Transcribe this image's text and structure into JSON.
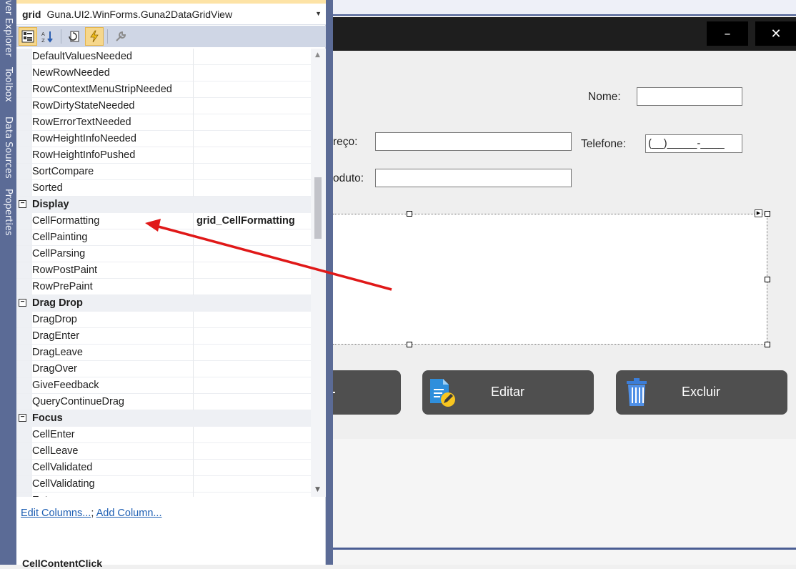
{
  "side_tabs": [
    "ver Explorer",
    "Toolbox",
    "Data Sources",
    "Properties"
  ],
  "properties": {
    "object_name": "grid",
    "object_type": "Guna.UI2.WinForms.Guna2DataGridView",
    "toolbar": {
      "categorized_icon": "categorized-icon",
      "alphabetical_icon": "alphabetical-icon",
      "properties_icon": "properties-icon",
      "events_icon": "lightning-icon",
      "property_pages_icon": "wrench-icon"
    },
    "rows": [
      {
        "type": "prop",
        "name": "DefaultValuesNeeded",
        "value": ""
      },
      {
        "type": "prop",
        "name": "NewRowNeeded",
        "value": ""
      },
      {
        "type": "prop",
        "name": "RowContextMenuStripNeeded",
        "value": ""
      },
      {
        "type": "prop",
        "name": "RowDirtyStateNeeded",
        "value": ""
      },
      {
        "type": "prop",
        "name": "RowErrorTextNeeded",
        "value": ""
      },
      {
        "type": "prop",
        "name": "RowHeightInfoNeeded",
        "value": ""
      },
      {
        "type": "prop",
        "name": "RowHeightInfoPushed",
        "value": ""
      },
      {
        "type": "prop",
        "name": "SortCompare",
        "value": ""
      },
      {
        "type": "prop",
        "name": "Sorted",
        "value": ""
      },
      {
        "type": "cat",
        "name": "Display",
        "value": ""
      },
      {
        "type": "prop",
        "name": "CellFormatting",
        "value": "grid_CellFormatting"
      },
      {
        "type": "prop",
        "name": "CellPainting",
        "value": ""
      },
      {
        "type": "prop",
        "name": "CellParsing",
        "value": ""
      },
      {
        "type": "prop",
        "name": "RowPostPaint",
        "value": ""
      },
      {
        "type": "prop",
        "name": "RowPrePaint",
        "value": ""
      },
      {
        "type": "cat",
        "name": "Drag Drop",
        "value": ""
      },
      {
        "type": "prop",
        "name": "DragDrop",
        "value": ""
      },
      {
        "type": "prop",
        "name": "DragEnter",
        "value": ""
      },
      {
        "type": "prop",
        "name": "DragLeave",
        "value": ""
      },
      {
        "type": "prop",
        "name": "DragOver",
        "value": ""
      },
      {
        "type": "prop",
        "name": "GiveFeedback",
        "value": ""
      },
      {
        "type": "prop",
        "name": "QueryContinueDrag",
        "value": ""
      },
      {
        "type": "cat",
        "name": "Focus",
        "value": ""
      },
      {
        "type": "prop",
        "name": "CellEnter",
        "value": ""
      },
      {
        "type": "prop",
        "name": "CellLeave",
        "value": ""
      },
      {
        "type": "prop",
        "name": "CellValidated",
        "value": ""
      },
      {
        "type": "prop",
        "name": "CellValidating",
        "value": ""
      },
      {
        "type": "prop",
        "name": "Enter",
        "value": ""
      }
    ],
    "links": {
      "edit_columns": "Edit Columns...",
      "separator": ";",
      "add_column": "Add Column..."
    },
    "description_title": "CellContentClick"
  },
  "form": {
    "window_buttons": {
      "minimize": "–",
      "close": "✕"
    },
    "labels": {
      "nome": "Nome:",
      "endereco": "reço:",
      "telefone": "Telefone:",
      "produto": "oduto:"
    },
    "telefone_mask": "(__)_____-____",
    "buttons": {
      "editar": "Editar",
      "excluir": "Excluir"
    },
    "colors": {
      "button_bg": "#4f4f4f",
      "title_bar": "#1e1e1e",
      "arrow": "#e01818"
    }
  }
}
